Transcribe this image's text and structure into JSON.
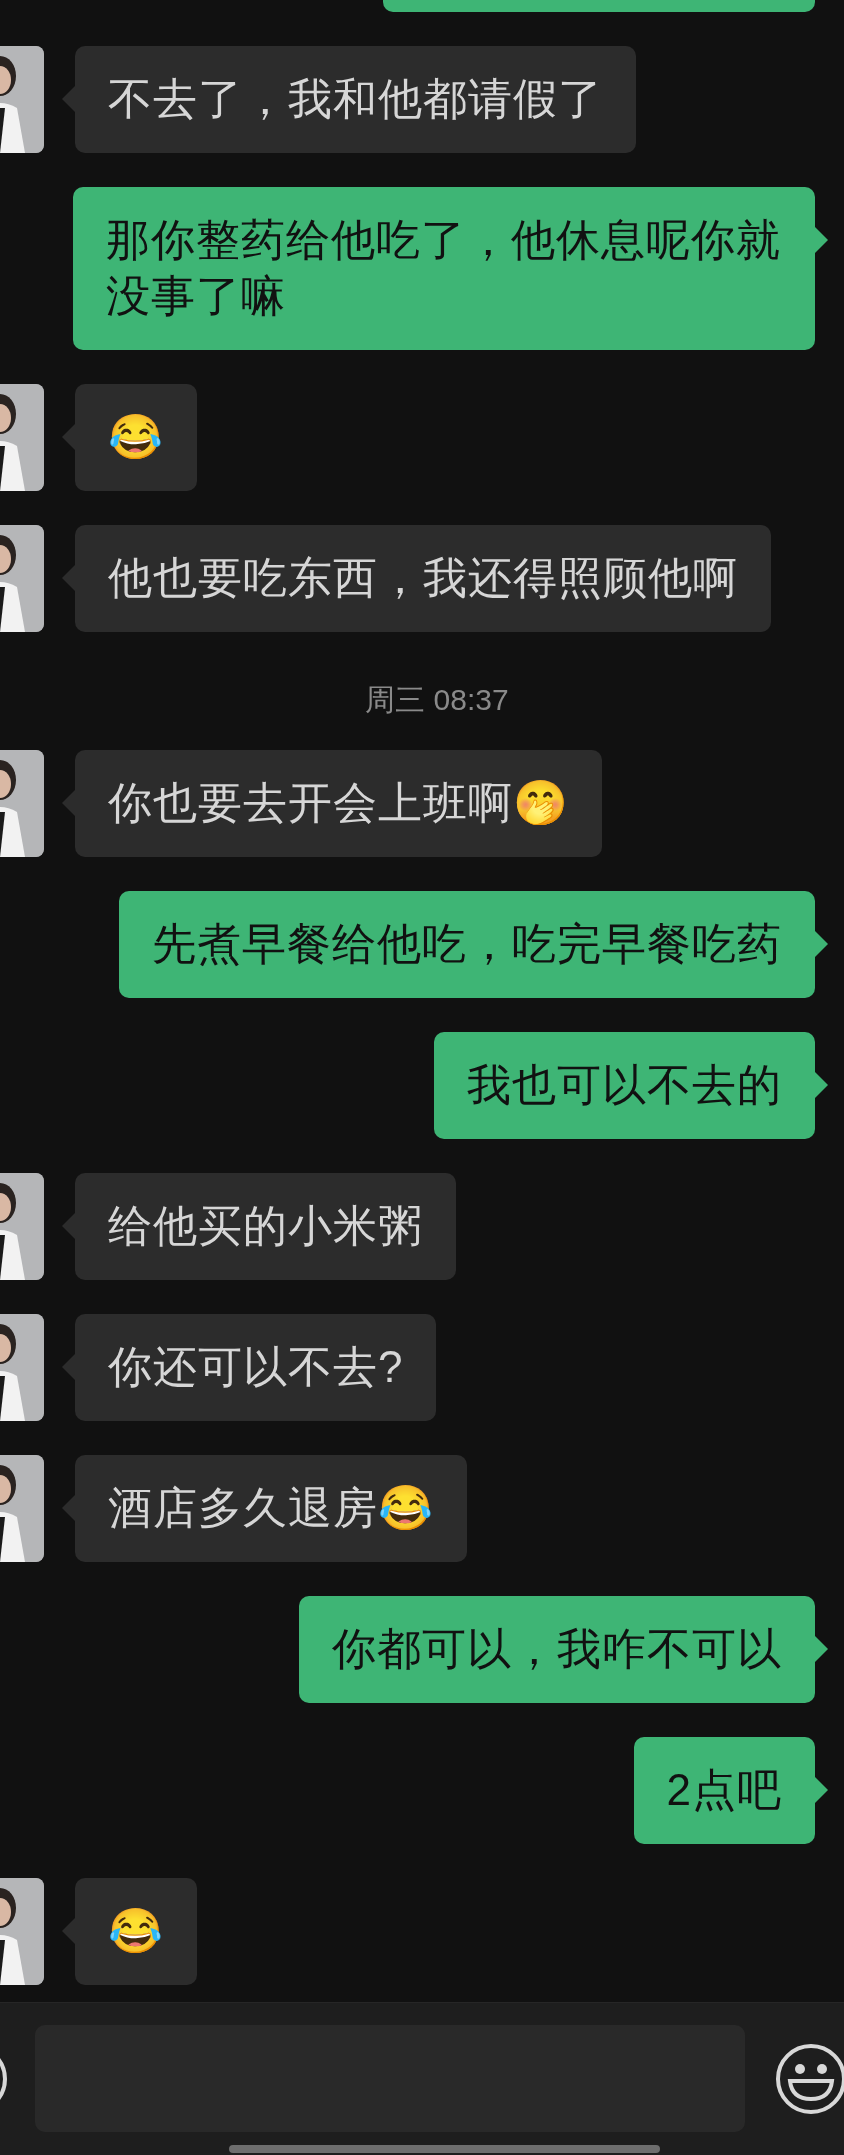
{
  "messages": [
    {
      "outgoing": true,
      "kind": "clipped"
    },
    {
      "outgoing": false,
      "kind": "text",
      "text": "不去了，我和他都请假了"
    },
    {
      "outgoing": true,
      "kind": "text",
      "text": "那你整药给他吃了，他休息呢你就没事了嘛"
    },
    {
      "outgoing": false,
      "kind": "text",
      "text": "😂"
    },
    {
      "outgoing": false,
      "kind": "text",
      "text": "他也要吃东西，我还得照顾他啊"
    },
    {
      "kind": "time",
      "text": "周三 08:37"
    },
    {
      "outgoing": false,
      "kind": "text",
      "text": "你也要去开会上班啊🤭"
    },
    {
      "outgoing": true,
      "kind": "text",
      "text": "先煮早餐给他吃，吃完早餐吃药"
    },
    {
      "outgoing": true,
      "kind": "text",
      "text": "我也可以不去的"
    },
    {
      "outgoing": false,
      "kind": "text",
      "text": "给他买的小米粥"
    },
    {
      "outgoing": false,
      "kind": "text",
      "text": "你还可以不去?"
    },
    {
      "outgoing": false,
      "kind": "text",
      "text": "酒店多久退房😂"
    },
    {
      "outgoing": true,
      "kind": "text",
      "text": "你都可以，我咋不可以"
    },
    {
      "outgoing": true,
      "kind": "text",
      "text": "2点吧"
    },
    {
      "outgoing": false,
      "kind": "text",
      "text": "😂"
    }
  ],
  "input": {
    "kind": "text"
  }
}
